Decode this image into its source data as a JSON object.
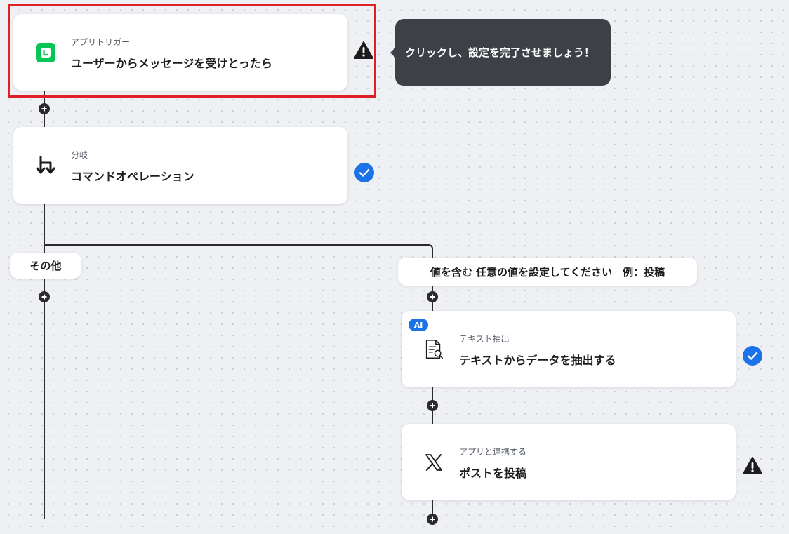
{
  "colors": {
    "accent_blue": "#1a73e8",
    "highlight_red": "#e11d26",
    "line_app_green": "#06c755",
    "tooltip_bg": "#3d4147",
    "connector": "#2b2b2b"
  },
  "tooltip": {
    "text": "クリックし、設定を完了させましょう！"
  },
  "nodes": [
    {
      "subtitle": "アプリトリガー",
      "title": "ユーザーからメッセージを受けとったら",
      "icon": "line-app-icon",
      "status": "warning-icon",
      "selected": true
    },
    {
      "subtitle": "分岐",
      "title": "コマンドオペレーション",
      "icon": "branch-icon",
      "status": "check-icon"
    },
    {
      "subtitle": "テキスト抽出",
      "title": "テキストからデータを抽出する",
      "icon": "document-search-icon",
      "status": "check-icon",
      "badge": "AI"
    },
    {
      "subtitle": "アプリと連携する",
      "title": "ポストを投稿",
      "icon": "x-logo-icon",
      "status": "warning-icon"
    }
  ],
  "branches": {
    "other_label": "その他",
    "condition_label": "値を含む 任意の値を設定してください　例：投稿"
  }
}
